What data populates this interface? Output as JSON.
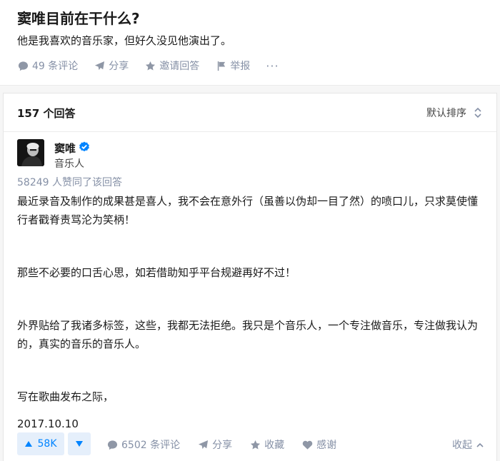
{
  "question": {
    "title": "窦唯目前在干什么?",
    "detail": "他是我喜欢的音乐家，但好久没见他演出了。",
    "actions": {
      "comments": "49 条评论",
      "share": "分享",
      "invite": "邀请回答",
      "report": "举报",
      "more": "···"
    }
  },
  "answers_header": {
    "count": "157 个回答",
    "sort": "默认排序"
  },
  "answer": {
    "author": {
      "name": "窦唯",
      "bio": "音乐人"
    },
    "votes_text": "58249 人赞同了该回答",
    "paragraphs": [
      "最近录音及制作的成果甚是喜人，我不会在意外行（虽善以伪却一目了然）的喷口儿，只求莫使懂行者戳脊责骂沦为笑柄！",
      "那些不必要的口舌心思，如若借助知乎平台规避再好不过！",
      "外界贴给了我诸多标签，这些，我都无法拒绝。我只是个音乐人，一个专注做音乐，专注做我认为的，真实的音乐的音乐人。",
      "写在歌曲发布之际，",
      "2017.10.10"
    ],
    "actions": {
      "upvote_count": "58K",
      "comments": "6502 条评论",
      "share": "分享",
      "collect": "收藏",
      "thanks": "感谢",
      "collapse": "收起"
    }
  },
  "colors": {
    "accent": "#0084ff",
    "muted": "#8590a6",
    "vote_bg": "#e5effb"
  }
}
